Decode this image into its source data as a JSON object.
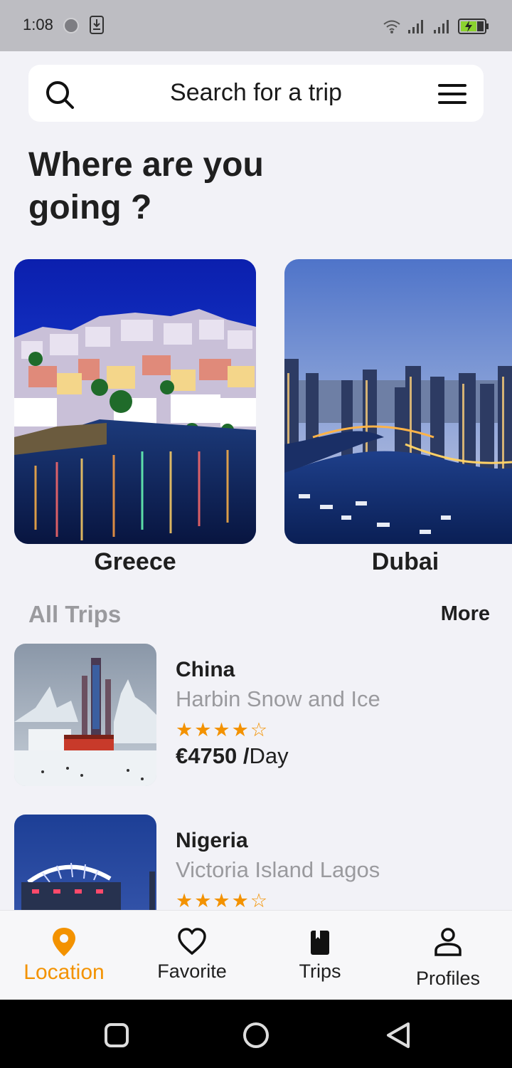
{
  "status_bar": {
    "time": "1:08"
  },
  "search": {
    "placeholder": "Search for a trip"
  },
  "headline": "Where are you going ?",
  "destinations": [
    {
      "label": "Greece"
    },
    {
      "label": "Dubai"
    }
  ],
  "section": {
    "title": "All Trips",
    "more_label": "More"
  },
  "trips": [
    {
      "country": "China",
      "place": "Harbin Snow and Ice",
      "rating": 4,
      "max_rating": 5,
      "stars": "★★★★☆",
      "price": "€4750 /",
      "unit": "Day"
    },
    {
      "country": "Nigeria",
      "place": "Victoria Island Lagos",
      "rating": 4,
      "max_rating": 5,
      "stars": "★★★★☆"
    }
  ],
  "bottom_nav": {
    "active": "Location",
    "items": [
      {
        "label": "Location",
        "icon": "location-pin-icon"
      },
      {
        "label": "Favorite",
        "icon": "heart-icon"
      },
      {
        "label": "Trips",
        "icon": "book-icon"
      },
      {
        "label": "Profiles",
        "icon": "person-icon"
      }
    ]
  },
  "colors": {
    "accent": "#f39200",
    "background": "#f2f2f7",
    "muted": "#9a9a9e"
  }
}
